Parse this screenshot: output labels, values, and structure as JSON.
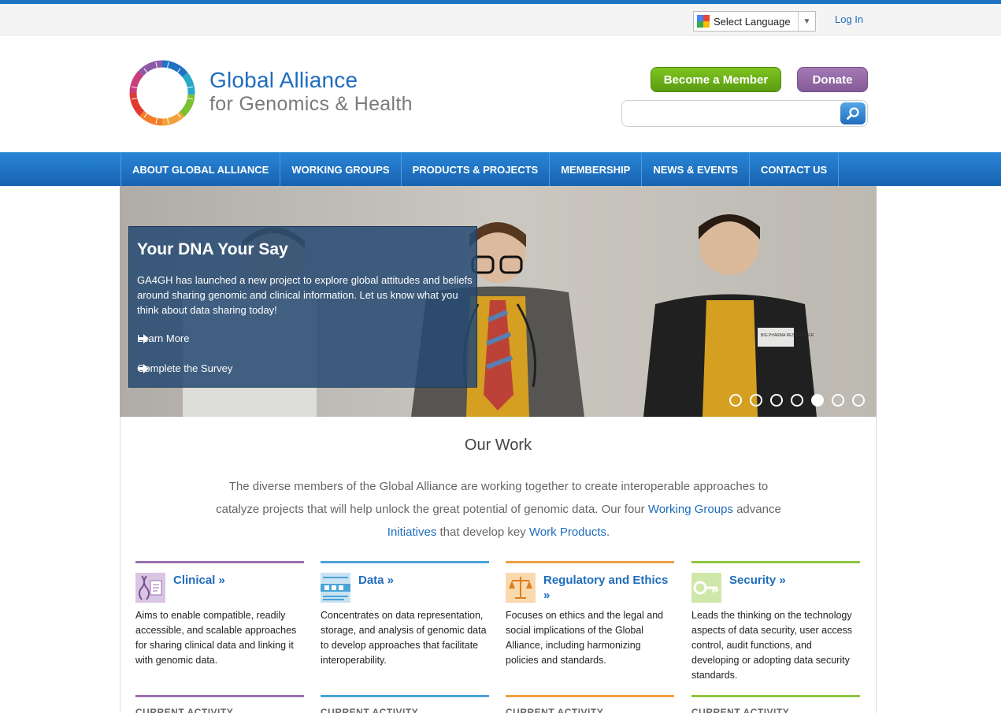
{
  "util": {
    "language_label": "Select Language",
    "login_label": "Log In"
  },
  "brand": {
    "line1": "Global Alliance",
    "line2": "for Genomics & Health"
  },
  "header": {
    "member_button": "Become a Member",
    "donate_button": "Donate",
    "search_placeholder": ""
  },
  "nav": {
    "items": [
      "ABOUT GLOBAL ALLIANCE",
      "WORKING GROUPS",
      "PRODUCTS & PROJECTS",
      "MEMBERSHIP",
      "NEWS & EVENTS",
      "CONTACT US"
    ]
  },
  "hero": {
    "title": "Your DNA Your Say",
    "description": "GA4GH has launched a new project to explore global attitudes and beliefs around sharing genomic and clinical information. Let us know what you think about data sharing today!",
    "link1": "Learn More",
    "link2": "Complete the Survey",
    "badge_text": "BIG PHARMA RESEARCHER",
    "slide_count": 7,
    "active_slide": 5
  },
  "our_work": {
    "title": "Our Work",
    "desc_part1": "The diverse members of the Global Alliance are working together to create interoperable approaches to catalyze projects that will help unlock the great potential of genomic data. Our four",
    "link_working_groups": "Working Groups",
    "desc_part2": "advance",
    "link_initiatives": "Initiatives",
    "desc_part3": "that develop key",
    "link_work_products": "Work Products",
    "desc_end": "."
  },
  "groups": [
    {
      "title": "Clinical »",
      "description": "Aims to enable compatible, readily accessible, and scalable approaches for sharing clinical data and linking it with genomic data.",
      "color": "#9b6fb0",
      "icon": "clinical-icon",
      "current": "CURRENT ACTIVITY"
    },
    {
      "title": "Data »",
      "description": "Concentrates on data representation, storage, and analysis of genomic data to develop approaches that facilitate interoperability.",
      "color": "#4aa3d8",
      "icon": "data-icon",
      "current": "CURRENT ACTIVITY"
    },
    {
      "title": "Regulatory and Ethics »",
      "description": "Focuses on ethics and the legal and social implications of the Global Alliance, including harmonizing policies and standards.",
      "color": "#f0a042",
      "icon": "regulatory-icon",
      "current": "CURRENT ACTIVITY"
    },
    {
      "title": "Security »",
      "description": "Leads the thinking on the technology aspects of data security, user access control, audit functions, and developing or adopting data security standards.",
      "color": "#8cc63f",
      "icon": "security-icon",
      "current": "CURRENT ACTIVITY"
    }
  ],
  "colors": {
    "brand_blue": "#1f6cbd",
    "nav_blue": "#1f73c2",
    "member_green": "#6aae18",
    "donate_purple": "#9066a3"
  }
}
